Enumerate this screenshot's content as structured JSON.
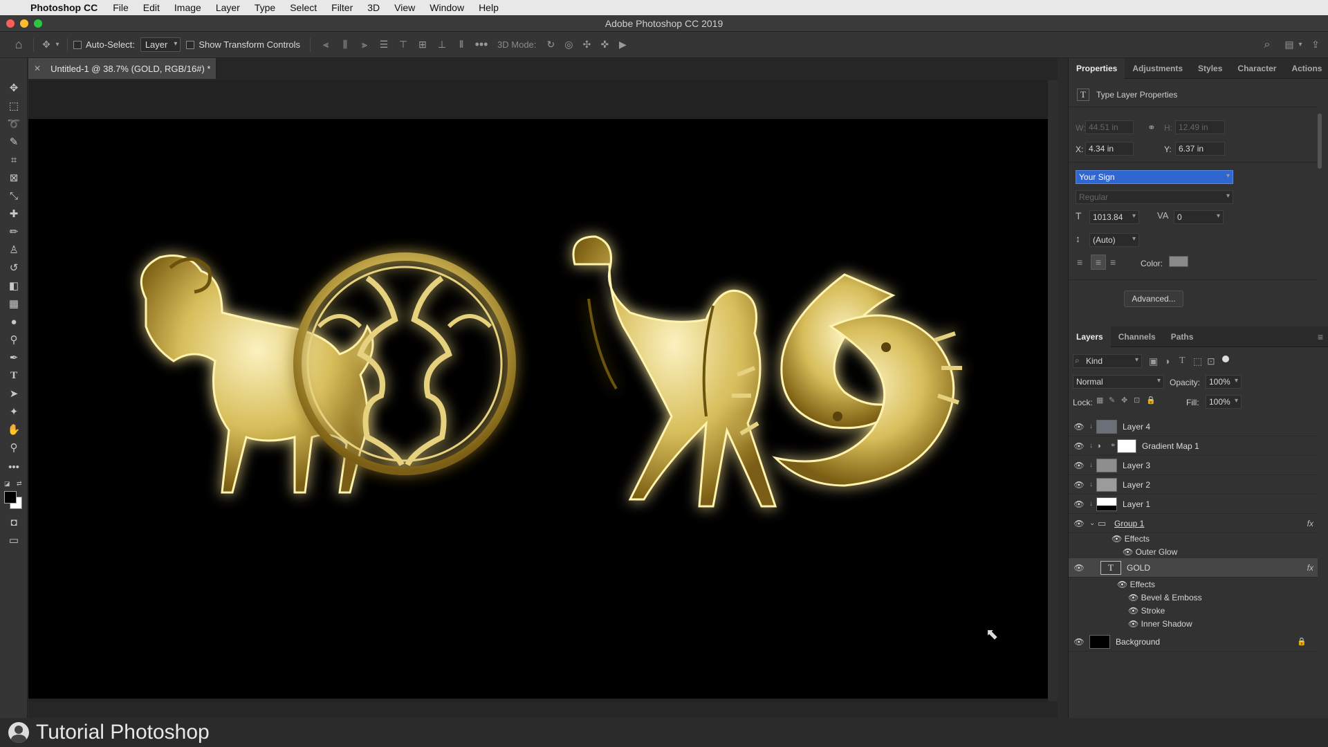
{
  "menubar": {
    "app": "Photoshop CC",
    "items": [
      "File",
      "Edit",
      "Image",
      "Layer",
      "Type",
      "Select",
      "Filter",
      "3D",
      "View",
      "Window",
      "Help"
    ]
  },
  "window": {
    "title": "Adobe Photoshop CC 2019"
  },
  "options": {
    "auto_select_label": "Auto-Select:",
    "auto_select_value": "Layer",
    "show_transform_label": "Show Transform Controls",
    "mode_3d_label": "3D Mode:"
  },
  "document": {
    "tab_title": "Untitled-1 @ 38.7% (GOLD, RGB/16#) *"
  },
  "properties": {
    "tabs": [
      "Properties",
      "Adjustments",
      "Styles",
      "Character",
      "Actions"
    ],
    "header": "Type Layer Properties",
    "w_label": "W:",
    "w_value": "44.51 in",
    "h_label": "H:",
    "h_value": "12.49 in",
    "x_label": "X:",
    "x_value": "4.34 in",
    "y_label": "Y:",
    "y_value": "6.37 in",
    "font_family": "Your Sign",
    "font_style": "Regular",
    "font_size": "1013.84",
    "tracking": "0",
    "leading": "(Auto)",
    "color_label": "Color:",
    "advanced_label": "Advanced..."
  },
  "layers": {
    "tabs": [
      "Layers",
      "Channels",
      "Paths"
    ],
    "filter": "Kind",
    "blend_mode": "Normal",
    "opacity_label": "Opacity:",
    "opacity_value": "100%",
    "lock_label": "Lock:",
    "fill_label": "Fill:",
    "fill_value": "100%",
    "rows": [
      {
        "name": "Layer 4"
      },
      {
        "name": "Gradient Map 1"
      },
      {
        "name": "Layer 3"
      },
      {
        "name": "Layer 2"
      },
      {
        "name": "Layer 1"
      },
      {
        "name": "Group 1"
      },
      {
        "name": "GOLD"
      },
      {
        "name": "Background"
      }
    ],
    "group_effects": {
      "label": "Effects",
      "items": [
        "Outer Glow"
      ]
    },
    "gold_effects": {
      "label": "Effects",
      "items": [
        "Bevel & Emboss",
        "Stroke",
        "Inner Shadow"
      ]
    },
    "fx_label": "fx"
  },
  "footer": {
    "brand": "Tutorial Photoshop"
  },
  "colors": {
    "accent_gold": "#e7d27a",
    "selection": "#2f66d0"
  }
}
